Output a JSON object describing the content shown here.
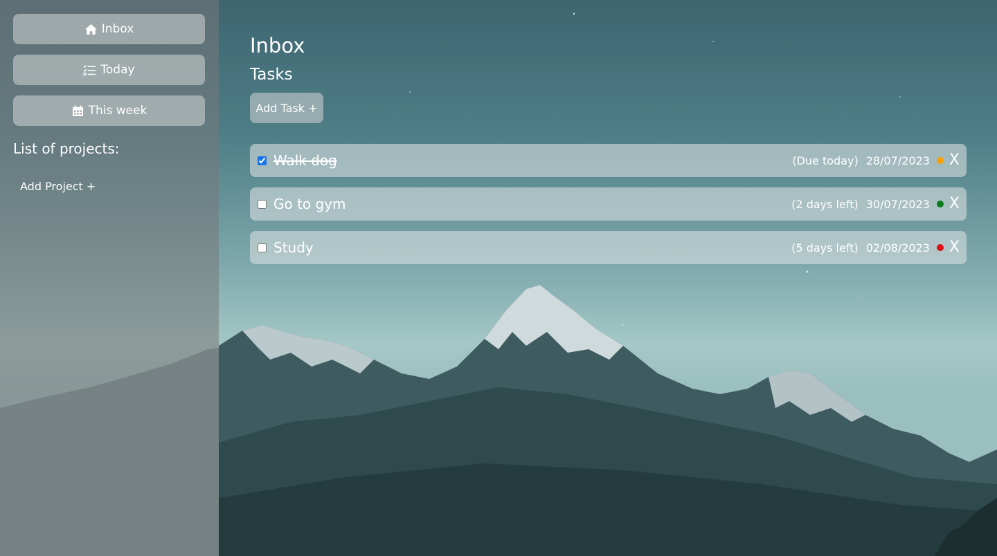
{
  "sidebar": {
    "nav": [
      {
        "label": "Inbox",
        "icon": "home-icon"
      },
      {
        "label": "Today",
        "icon": "checklist-icon"
      },
      {
        "label": "This week",
        "icon": "calendar-icon"
      }
    ],
    "projects_heading": "List of projects:",
    "add_project_label": "Add Project +"
  },
  "main": {
    "title": "Inbox",
    "section_title": "Tasks",
    "add_task_label": "Add Task +",
    "tasks": [
      {
        "name": "Walk dog",
        "done": true,
        "remaining": "(Due today)",
        "date": "28/07/2023",
        "priority_color": "#f5a000",
        "delete_label": "X"
      },
      {
        "name": "Go to gym",
        "done": false,
        "remaining": "(2 days left)",
        "date": "30/07/2023",
        "priority_color": "#0a7d1a",
        "delete_label": "X"
      },
      {
        "name": "Study",
        "done": false,
        "remaining": "(5 days left)",
        "date": "02/08/2023",
        "priority_color": "#e0101a",
        "delete_label": "X"
      }
    ]
  },
  "colors": {
    "checkbox_accent": "#1a73e8",
    "sidebar_bg": "rgba(120,120,120,0.55)"
  }
}
